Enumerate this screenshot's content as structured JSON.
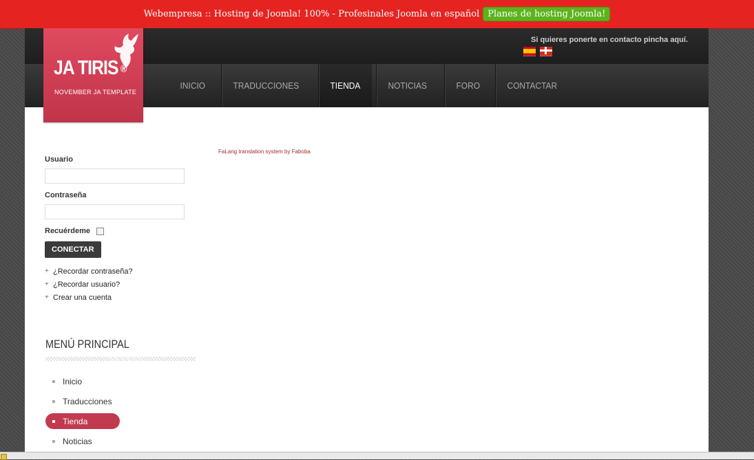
{
  "promo": {
    "text": "Webempresa :: Hosting de Joomla! 100% - Profesinales Joomla en español",
    "button_label": "Planes de hosting Joomla!"
  },
  "header": {
    "contact_text": "Si quieres ponerte en contacto pincha aquí.",
    "languages": [
      "es-flag-icon",
      "eu-flag-icon"
    ]
  },
  "logo": {
    "title": "JA TIRIS",
    "registered": "®",
    "subtitle": "NOVEMBER JA TEMPLATE"
  },
  "nav": {
    "items": [
      "INICIO",
      "TRADUCCIONES",
      "TIENDA",
      "NOTICIAS",
      "FORO",
      "CONTACTAR"
    ],
    "active": "TIENDA"
  },
  "falang_text": "FaLang translation system by Faboba",
  "login": {
    "username_label": "Usuario",
    "username_value": "",
    "password_label": "Contraseña",
    "password_value": "",
    "remember_label": "Recuérdeme",
    "remember_checked": false,
    "submit_label": "CONECTAR",
    "links": [
      "¿Recordar contraseña?",
      "¿Recordar usuario?",
      "Crear una cuenta"
    ]
  },
  "main_menu": {
    "title": "MENÚ PRINCIPAL",
    "items": [
      "Inicio",
      "Traducciones",
      "Tienda",
      "Noticias"
    ],
    "active": "Tienda"
  },
  "colors": {
    "promo_bg": "#e52422",
    "promo_button": "#5cb31c",
    "brand": "#c23a4f"
  }
}
